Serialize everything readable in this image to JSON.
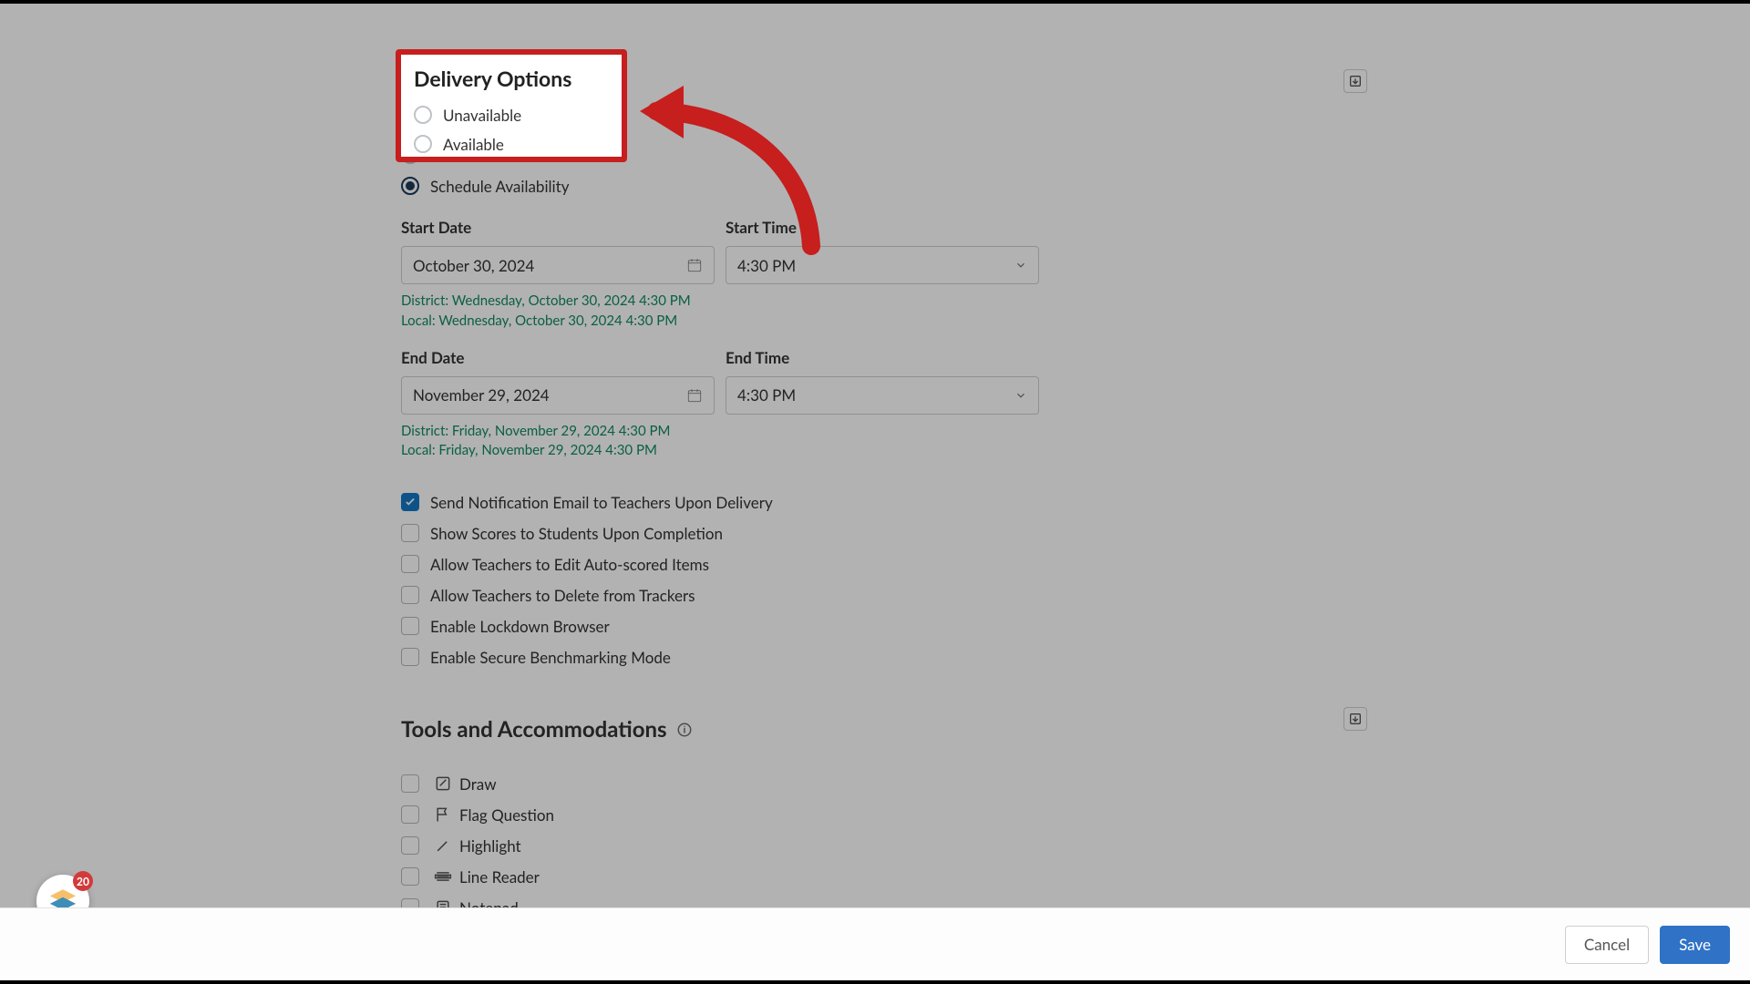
{
  "section_delivery": {
    "title": "Delivery Options",
    "options": {
      "unavailable": "Unavailable",
      "available": "Available",
      "schedule": "Schedule Availability"
    },
    "selected": "schedule"
  },
  "schedule": {
    "start_date": {
      "label": "Start Date",
      "value": "October 30, 2024"
    },
    "start_time": {
      "label": "Start Time",
      "value": "4:30 PM"
    },
    "start_tz_district": "District: Wednesday, October 30, 2024 4:30 PM",
    "start_tz_local": "Local: Wednesday, October 30, 2024 4:30 PM",
    "end_date": {
      "label": "End Date",
      "value": "November 29, 2024"
    },
    "end_time": {
      "label": "End Time",
      "value": "4:30 PM"
    },
    "end_tz_district": "District: Friday, November 29, 2024 4:30 PM",
    "end_tz_local": "Local: Friday, November 29, 2024 4:30 PM"
  },
  "delivery_checks": [
    {
      "label": "Send Notification Email to Teachers Upon Delivery",
      "checked": true
    },
    {
      "label": "Show Scores to Students Upon Completion",
      "checked": false
    },
    {
      "label": "Allow Teachers to Edit Auto-scored Items",
      "checked": false
    },
    {
      "label": "Allow Teachers to Delete from Trackers",
      "checked": false
    },
    {
      "label": "Enable Lockdown Browser",
      "checked": false
    },
    {
      "label": "Enable Secure Benchmarking Mode",
      "checked": false
    }
  ],
  "tools_section": {
    "title": "Tools and Accommodations",
    "items": [
      {
        "icon": "draw",
        "label": "Draw"
      },
      {
        "icon": "flag",
        "label": "Flag Question"
      },
      {
        "icon": "highlight",
        "label": "Highlight"
      },
      {
        "icon": "linereader",
        "label": "Line Reader"
      },
      {
        "icon": "notepad",
        "label": "Notepad"
      }
    ]
  },
  "footer": {
    "cancel": "Cancel",
    "save": "Save"
  },
  "badge": {
    "count": "20"
  }
}
